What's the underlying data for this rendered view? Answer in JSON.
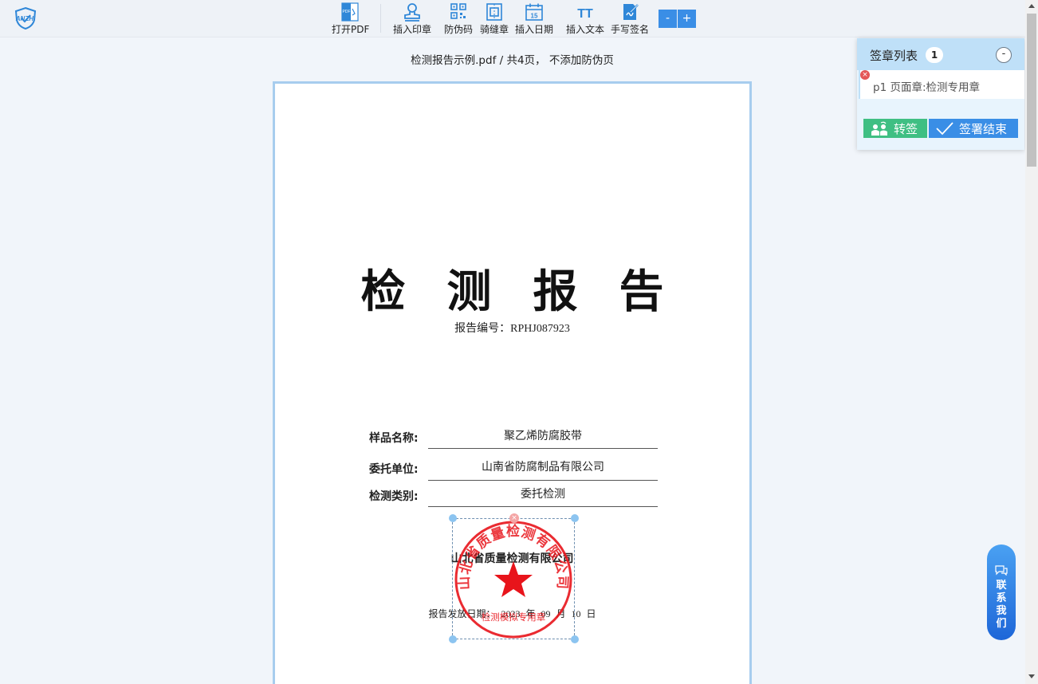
{
  "toolbar": {
    "logo_text": "ANZHI",
    "open_pdf": "打开PDF",
    "insert_seal": "插入印章",
    "anti_fake_code": "防伪码",
    "seam_seal": "骑缝章",
    "insert_date": "插入日期",
    "insert_text": "插入文本",
    "handwritten_signature": "手写签名",
    "zoom_out": "-",
    "zoom_in": "+",
    "icons": {
      "open_pdf": "pdf-file-icon",
      "insert_seal": "stamp-icon",
      "anti_fake_code": "qr-code-icon",
      "seam_seal": "seam-seal-icon",
      "insert_date": "calendar-icon",
      "insert_text": "text-icon",
      "handwritten_signature": "pen-signature-icon"
    },
    "calendar_day": "15",
    "text_icon_glyph": "TT",
    "pdf_icon_text": "PDF"
  },
  "file_info": "检测报告示例.pdf / 共4页， 不添加防伪页",
  "document": {
    "title": "检测报告",
    "report_no": "报告编号：RPHJ087923",
    "fields": [
      {
        "label": "样品名称:",
        "value": "聚乙烯防腐胶带"
      },
      {
        "label": "委托单位:",
        "value": "山南省防腐制品有限公司"
      },
      {
        "label": "检测类别:",
        "value": "委托检测"
      }
    ],
    "issuer": "山北省质量检测有限公司",
    "issue_date": "报告发放日期： 2023 年 09 月 10 日"
  },
  "stamp": {
    "ring_text": "山北省质量检测有限公司",
    "bottom_text": "检测模拟专用章",
    "color": "#e8141b",
    "delete": "×"
  },
  "signature_panel": {
    "title": "签章列表",
    "count": "1",
    "collapse": "-",
    "items": [
      {
        "label": "p1 页面章:检测专用章"
      }
    ],
    "item_delete": "×",
    "transfer_button": "转签",
    "finish_button": "签署结束"
  },
  "contact": {
    "label": "联系我们"
  },
  "colors": {
    "accent": "#3a8ee6",
    "green": "#3fbf83",
    "page_border": "#a7cdee",
    "panel_header": "#bfe0f8"
  }
}
